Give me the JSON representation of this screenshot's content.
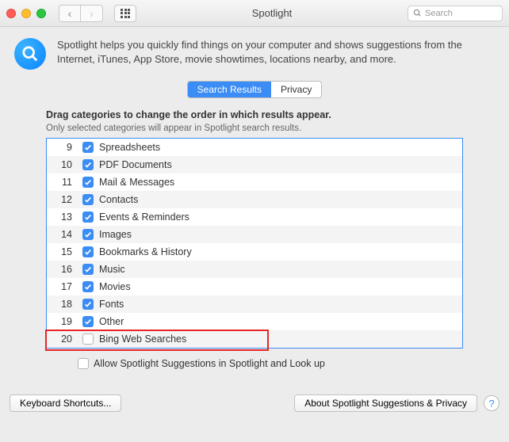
{
  "titlebar": {
    "title": "Spotlight",
    "search_placeholder": "Search"
  },
  "header": {
    "description": "Spotlight helps you quickly find things on your computer and shows suggestions from the Internet, iTunes, App Store, movie showtimes, locations nearby, and more."
  },
  "tabs": {
    "search_results": "Search Results",
    "privacy": "Privacy"
  },
  "instructions": {
    "bold": "Drag categories to change the order in which results appear.",
    "sub": "Only selected categories will appear in Spotlight search results."
  },
  "categories": [
    {
      "num": "9",
      "label": "Spreadsheets",
      "checked": true
    },
    {
      "num": "10",
      "label": "PDF Documents",
      "checked": true
    },
    {
      "num": "11",
      "label": "Mail & Messages",
      "checked": true
    },
    {
      "num": "12",
      "label": "Contacts",
      "checked": true
    },
    {
      "num": "13",
      "label": "Events & Reminders",
      "checked": true
    },
    {
      "num": "14",
      "label": "Images",
      "checked": true
    },
    {
      "num": "15",
      "label": "Bookmarks & History",
      "checked": true
    },
    {
      "num": "16",
      "label": "Music",
      "checked": true
    },
    {
      "num": "17",
      "label": "Movies",
      "checked": true
    },
    {
      "num": "18",
      "label": "Fonts",
      "checked": true
    },
    {
      "num": "19",
      "label": "Other",
      "checked": true
    },
    {
      "num": "20",
      "label": "Bing Web Searches",
      "checked": false,
      "highlighted": true
    }
  ],
  "allow": {
    "label": "Allow Spotlight Suggestions in Spotlight and Look up",
    "checked": false
  },
  "footer": {
    "keyboard": "Keyboard Shortcuts...",
    "about": "About Spotlight Suggestions & Privacy",
    "help": "?"
  }
}
